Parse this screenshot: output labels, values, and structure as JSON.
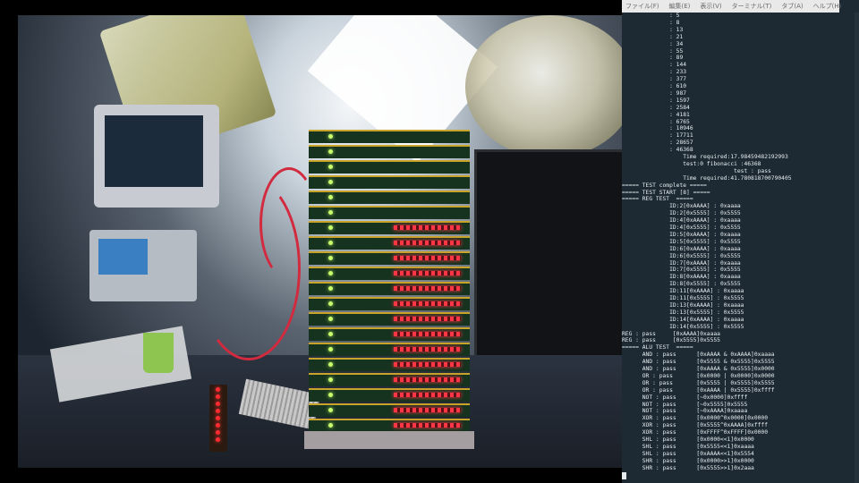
{
  "window": {
    "menu": [
      "ファイル(F)",
      "編集(E)",
      "表示(V)",
      "ターミナル(T)",
      "タブ(A)",
      "ヘルプ(H)"
    ]
  },
  "video_feed": {
    "description_icon": "camera-feed"
  },
  "terminal": {
    "colors": {
      "background": "#1e2a33",
      "text": "#e4ecf0"
    },
    "lines": [
      "              : 5",
      "              : 8",
      "              : 13",
      "              : 21",
      "              : 34",
      "              : 55",
      "              : 89",
      "              : 144",
      "              : 233",
      "              : 377",
      "              : 610",
      "              : 987",
      "              : 1597",
      "              : 2584",
      "              : 4181",
      "              : 6765",
      "              : 10946",
      "              : 17711",
      "              : 28657",
      "              : 46368",
      "                  Time required:17.98459482192993",
      "                  test:0 fibonacci :46368",
      "                                 test : pass",
      "                  Time required:41.780818700790405",
      "===== TEST complete =====",
      "===== TEST START [8] =====",
      "===== REG TEST  =====",
      "              ID:2[0xAAAA] : 0xaaaa",
      "              ID:2[0x5555] : 0x5555",
      "              ID:4[0xAAAA] : 0xaaaa",
      "              ID:4[0x5555] : 0x5555",
      "              ID:5[0xAAAA] : 0xaaaa",
      "              ID:5[0x5555] : 0x5555",
      "              ID:6[0xAAAA] : 0xaaaa",
      "              ID:6[0x5555] : 0x5555",
      "              ID:7[0xAAAA] : 0xaaaa",
      "              ID:7[0x5555] : 0x5555",
      "              ID:8[0xAAAA] : 0xaaaa",
      "              ID:8[0x5555] : 0x5555",
      "              ID:11[0xAAAA] : 0xaaaa",
      "              ID:11[0x5555] : 0x5555",
      "              ID:13[0xAAAA] : 0xaaaa",
      "              ID:13[0x5555] : 0x5555",
      "              ID:14[0xAAAA] : 0xaaaa",
      "              ID:14[0x5555] : 0x5555",
      "REG : pass     [0xAAAA]0xaaaa",
      "REG : pass     [0x5555]0x5555",
      "===== ALU TEST  =====",
      "      AND : pass      [0xAAAA & 0xAAAA]0xaaaa",
      "      AND : pass      [0x5555 & 0x5555]0x5555",
      "      AND : pass      [0xAAAA & 0x5555]0x0000",
      "      OR : pass       [0x0000 | 0x0000]0x0000",
      "      OR : pass       [0x5555 | 0x5555]0x5555",
      "      OR : pass       [0xAAAA | 0x5555]0xffff",
      "      NOT : pass      [~0x0000]0xffff",
      "      NOT : pass      [~0x5555]0x5555",
      "      NOT : pass      [~0xAAAA]0xaaaa",
      "      XOR : pass      [0x0000^0x0000]0x0000",
      "      XOR : pass      [0x5555^0xAAAA]0xffff",
      "      XOR : pass      [0xFFFF^0xFFFF]0x0000",
      "      SHL : pass      [0x0000<<1]0x0000",
      "      SHL : pass      [0x5555<<1]0xaaaa",
      "      SHL : pass      [0xAAAA<<1]0x5554",
      "      SHR : pass      [0x0000>>1]0x0000",
      "      SHR : pass      [0x5555>>1]0x2aaa"
    ]
  }
}
